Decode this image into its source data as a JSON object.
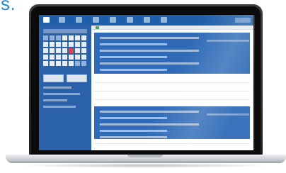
{
  "caption": {
    "fragment": "os."
  },
  "app": {
    "toolbar_icons": [
      "calendar-icon",
      "list-icon",
      "people-icon",
      "settings-icon",
      "upload-icon",
      "print-icon",
      "refresh-icon",
      "help-icon"
    ],
    "sidebar": {
      "selected_day_color": "#e04545"
    }
  },
  "colors": {
    "toolbar": "#1f5fa9",
    "sidebar": "#2b61a8",
    "event_block": "#2f6bb8",
    "caption": "#1a8fd0"
  }
}
